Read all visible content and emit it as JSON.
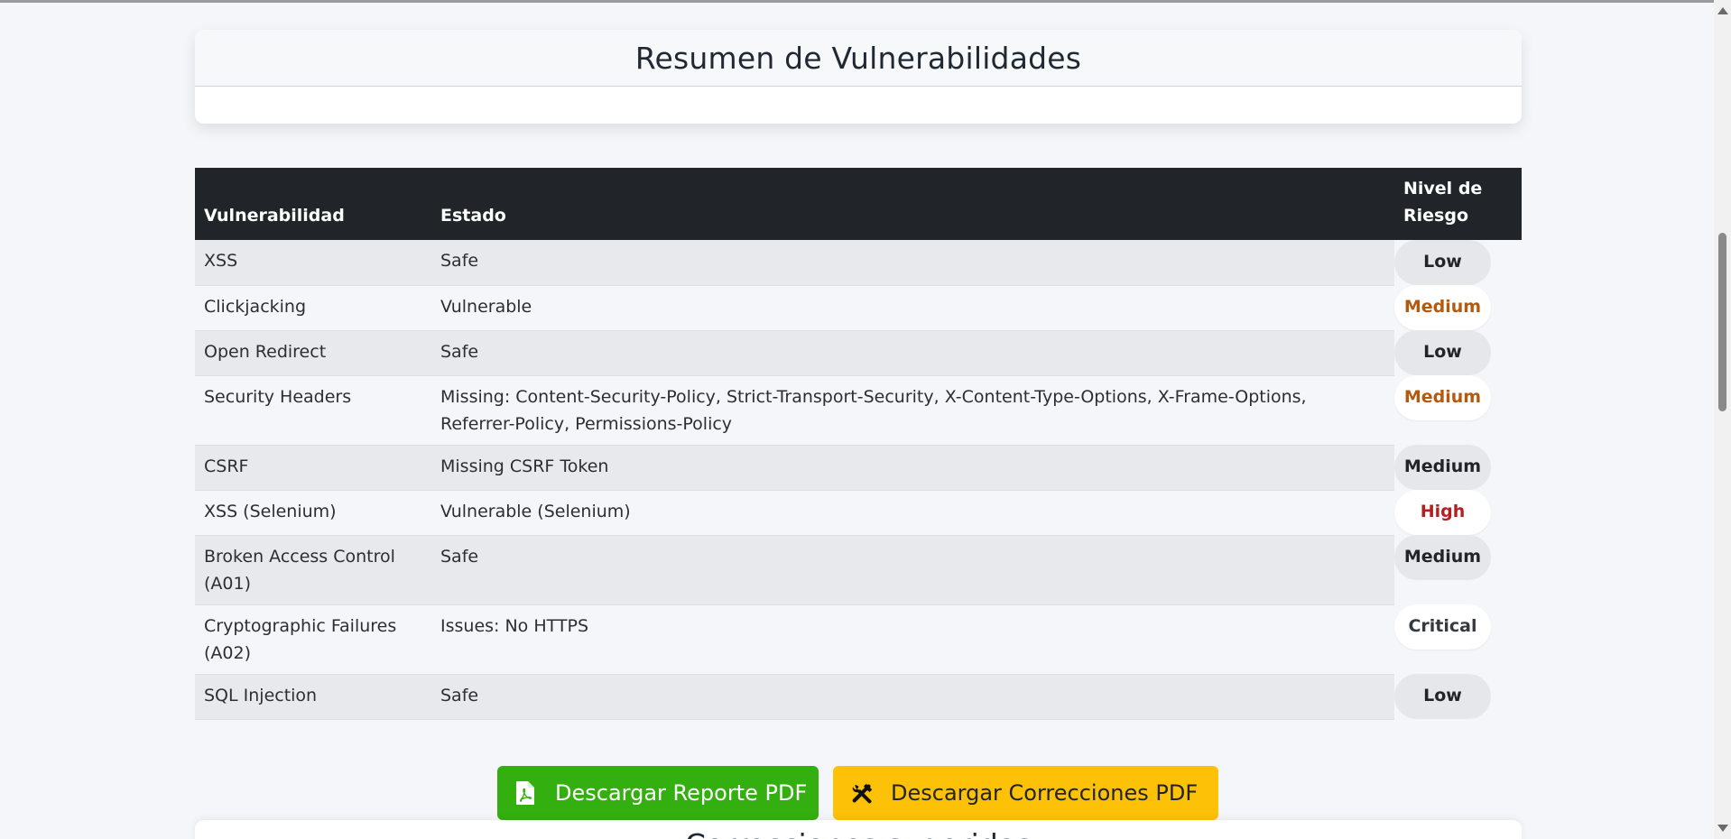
{
  "summary": {
    "title": "Resumen de Vulnerabilidades"
  },
  "table": {
    "headers": {
      "vulnerabilidad": "Vulnerabilidad",
      "estado": "Estado",
      "riesgo": "Nivel de Riesgo"
    },
    "rows": [
      {
        "name": "XSS",
        "status": "Safe",
        "risk": "Low",
        "risk_color": "#212529",
        "pill": "grey"
      },
      {
        "name": "Clickjacking",
        "status": "Vulnerable",
        "risk": "Medium",
        "risk_color": "#b5590f",
        "pill": "white"
      },
      {
        "name": "Open Redirect",
        "status": "Safe",
        "risk": "Low",
        "risk_color": "#212529",
        "pill": "grey"
      },
      {
        "name": "Security Headers",
        "status": "Missing: Content-Security-Policy, Strict-Transport-Security, X-Content-Type-Options, X-Frame-Options, Referrer-Policy, Permissions-Policy",
        "risk": "Medium",
        "risk_color": "#b5590f",
        "pill": "white"
      },
      {
        "name": "CSRF",
        "status": "Missing CSRF Token",
        "risk": "Medium",
        "risk_color": "#212529",
        "pill": "grey"
      },
      {
        "name": "XSS (Selenium)",
        "status": "Vulnerable (Selenium)",
        "risk": "High",
        "risk_color": "#b21f1f",
        "pill": "white"
      },
      {
        "name": "Broken Access Control (A01)",
        "status": "Safe",
        "risk": "Medium",
        "risk_color": "#212529",
        "pill": "grey"
      },
      {
        "name": "Cryptographic Failures (A02)",
        "status": "Issues: No HTTPS",
        "risk": "Critical",
        "risk_color": "#343a40",
        "pill": "white"
      },
      {
        "name": "SQL Injection",
        "status": "Safe",
        "risk": "Low",
        "risk_color": "#212529",
        "pill": "grey"
      }
    ]
  },
  "buttons": {
    "report_pdf": {
      "label": "Descargar Reporte PDF",
      "icon": "file-pdf-icon",
      "color": "#33b00f"
    },
    "corrections_pdf": {
      "label": "Descargar Correcciones PDF",
      "icon": "tools-icon",
      "color": "#fdc108"
    }
  },
  "next_section": {
    "title": "Correcciones sugeridas"
  }
}
